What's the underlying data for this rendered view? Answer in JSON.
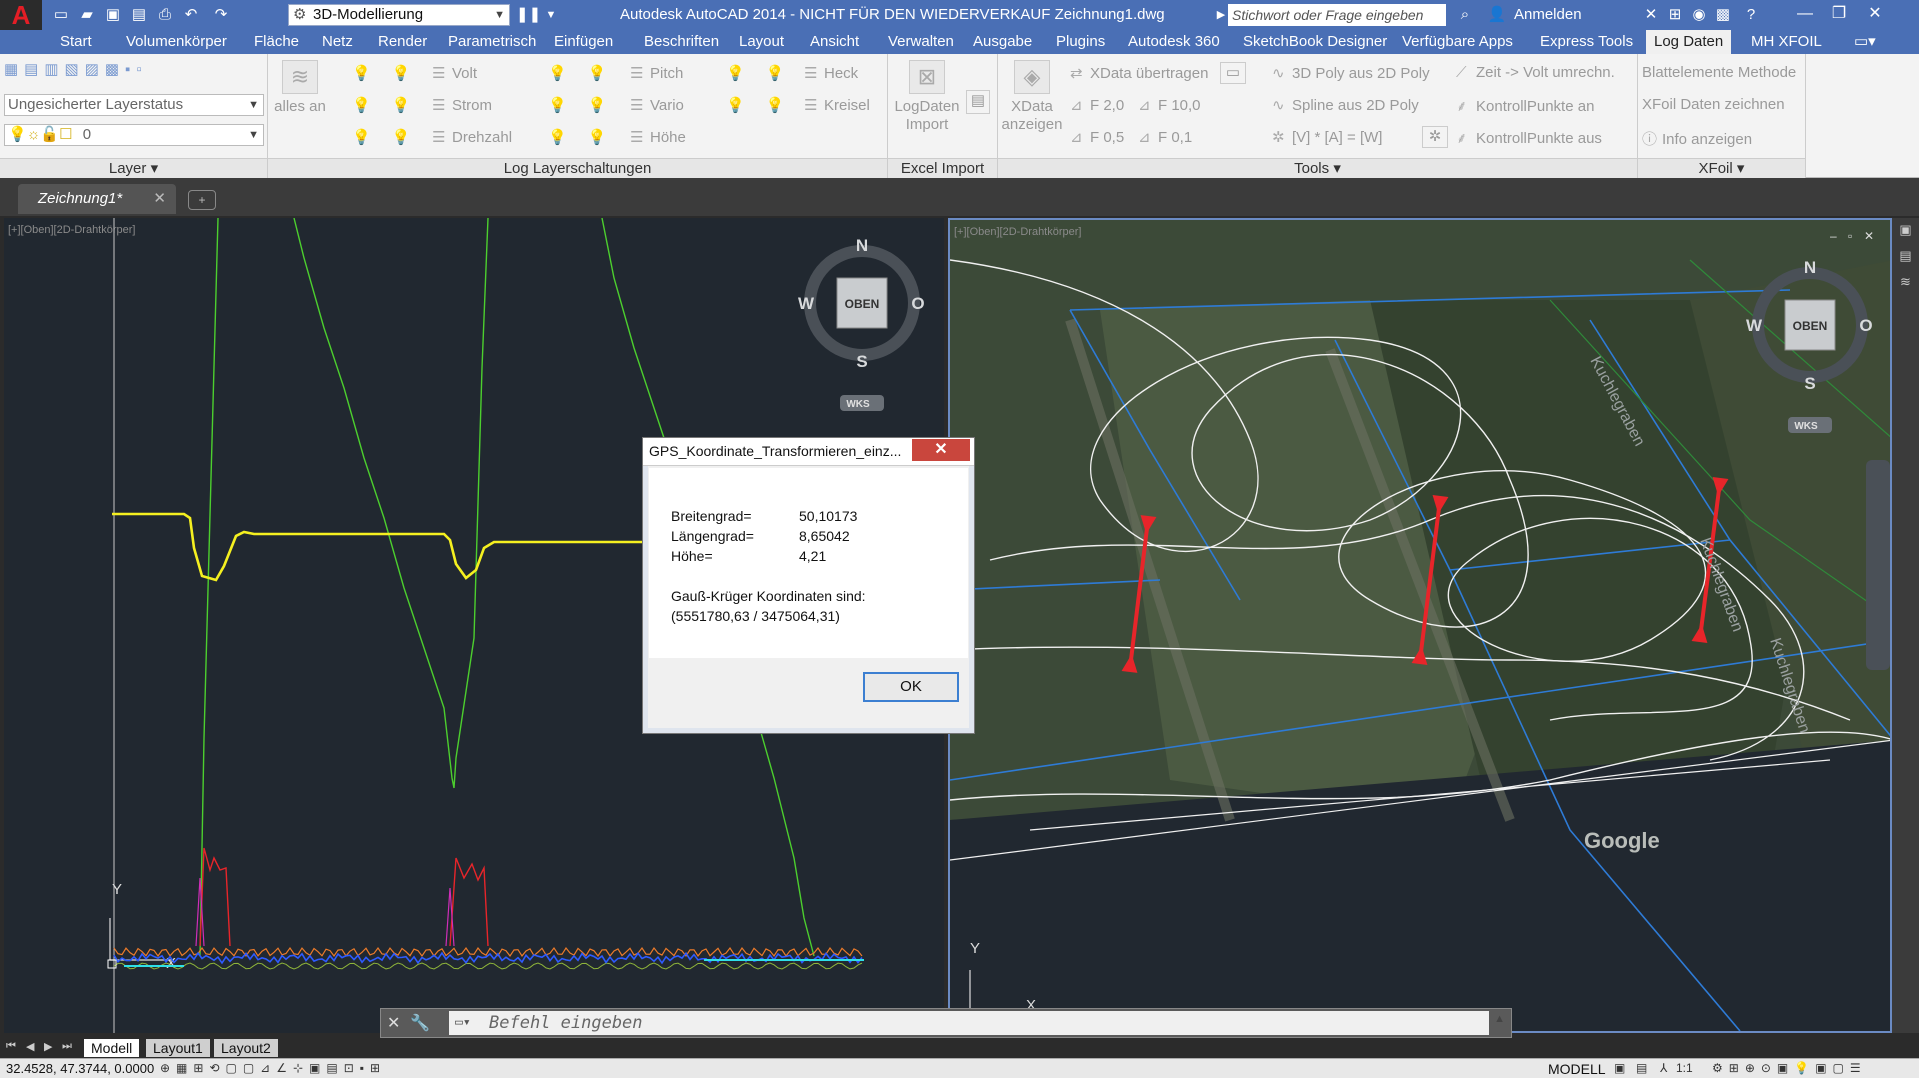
{
  "titlebar": {
    "workspace": "3D-Modellierung",
    "title": "Autodesk AutoCAD 2014 - NICHT FÜR DEN WIEDERVERKAUF    Zeichnung1.dwg",
    "search_placeholder": "Stichwort oder Frage eingeben",
    "signin": "Anmelden"
  },
  "ribbon_tabs": [
    "Start",
    "Volumenkörper",
    "Fläche",
    "Netz",
    "Render",
    "Parametrisch",
    "Einfügen",
    "Beschriften",
    "Layout",
    "Ansicht",
    "Verwalten",
    "Ausgabe",
    "Plugins",
    "Autodesk 360",
    "SketchBook Designer",
    "Verfügbare Apps",
    "Express Tools",
    "Log Daten",
    "MH XFOIL"
  ],
  "active_tab": "Log Daten",
  "ribbon": {
    "layer": {
      "title": "Layer",
      "state": "Ungesicherter Layerstatus",
      "current": "0"
    },
    "log_layers": {
      "title": "Log Layerschaltungen",
      "all_on": "alles an",
      "col1": [
        "Volt",
        "Strom",
        "Drehzahl"
      ],
      "col2": [
        "Pitch",
        "Vario",
        "Höhe"
      ],
      "col3": [
        "Heck",
        "Kreisel"
      ]
    },
    "excel": {
      "title": "Excel Import",
      "logdaten_import": "LogDaten Import"
    },
    "tools": {
      "title": "Tools",
      "xdata_anzeigen": "XData anzeigen",
      "xdata_uebertragen": "XData übertragen",
      "f20": "F 2,0",
      "f100": "F 10,0",
      "f05": "F 0,5",
      "f01": "F 0,1",
      "poly3d2d": "3D Poly aus 2D Poly",
      "spline2d": "Spline aus 2D Poly",
      "formula": "[V] * [A] = [W]",
      "zeit_volt": "Zeit -> Volt umrechn.",
      "kp_an": "KontrollPunkte an",
      "kp_aus": "KontrollPunkte aus"
    },
    "xfoil": {
      "title": "XFoil",
      "blatt": "Blattelemente Methode",
      "xfoil_draw": "XFoil Daten zeichnen",
      "info": "Info anzeigen"
    }
  },
  "document_tab": "Zeichnung1*",
  "viewports": {
    "left_label": "[+][Oben][2D-Drahtkörper]",
    "right_label": "[+][Oben][2D-Drahtkörper]",
    "compass": {
      "n": "N",
      "s": "S",
      "w": "W",
      "o": "O",
      "center": "OBEN",
      "wcs": "WKS"
    },
    "watermark": "Google",
    "map_labels": [
      "Kuchlegraben",
      "Kuchlegraben",
      "Kuchlegraben"
    ]
  },
  "dialog": {
    "title": "GPS_Koordinate_Transformieren_einz...",
    "rows": [
      {
        "label": "Breitengrad=",
        "value": "50,10173"
      },
      {
        "label": "Längengrad=",
        "value": "8,65042"
      },
      {
        "label": "Höhe=",
        "value": "4,21"
      }
    ],
    "gk_label": "Gauß-Krüger Koordinaten sind:",
    "gk_value": "(5551780,63 / 3475064,31)",
    "ok": "OK"
  },
  "command": {
    "placeholder": "Befehl eingeben"
  },
  "layout_tabs": [
    "Modell",
    "Layout1",
    "Layout2"
  ],
  "status": {
    "coords": "32.4528, 47.3744, 0.0000",
    "model": "MODELL",
    "scale": "1:1"
  },
  "colors": {
    "title_blue": "#4a6fb5",
    "viewport_bg": "#212830",
    "yellow": "#f5f020",
    "green": "#4ccf2e",
    "red_arrow": "#e8252a"
  }
}
